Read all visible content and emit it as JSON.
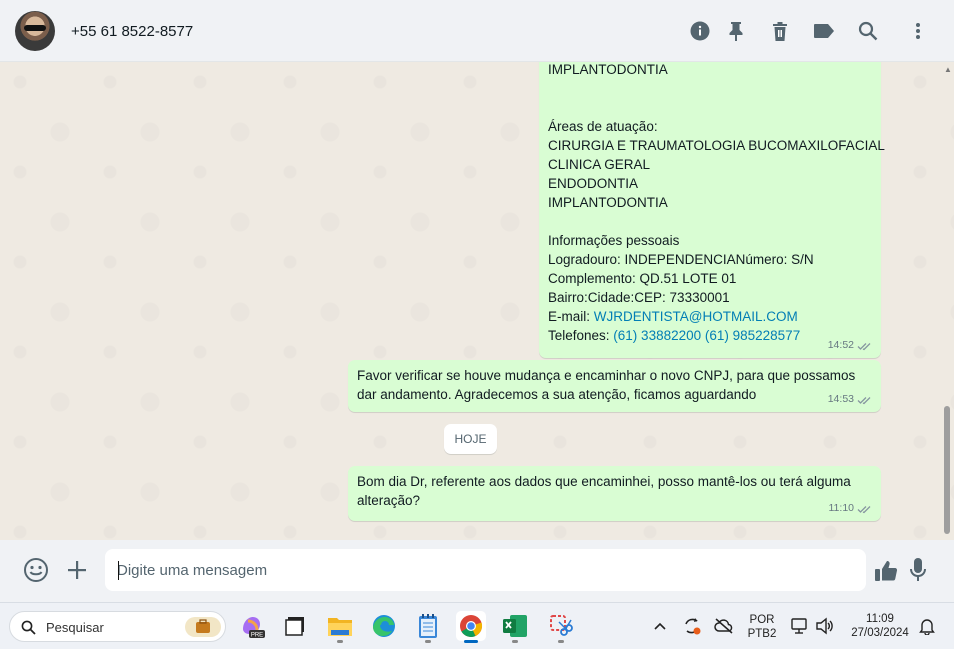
{
  "header": {
    "contact_name": "+55 61 8522-8577",
    "icons": [
      "info-icon",
      "pin-icon",
      "trash-icon",
      "label-icon",
      "search-icon",
      "more-icon"
    ]
  },
  "messages": [
    {
      "lines": [
        "IMPLANTODONTIA",
        "",
        "",
        "Áreas de atuação:",
        "CIRURGIA E TRAUMATOLOGIA BUCOMAXILOFACIAL",
        "CLINICA GERAL",
        "ENDODONTIA",
        "IMPLANTODONTIA",
        "",
        "Informações pessoais",
        "Logradouro: INDEPENDENCIANúmero: S/N",
        "Complemento: QD.51 LOTE 01",
        "Bairro:Cidade:CEP: 73330001"
      ],
      "email_label": "E-mail: ",
      "email": "WJRDENTISTA@HOTMAIL.COM",
      "phones_label": "Telefones: ",
      "phones": "(61) 33882200 (61) 985228577",
      "time": "14:52"
    },
    {
      "lines": [
        "Favor verificar se houve mudança e encaminhar o novo CNPJ, para que possamos",
        "dar andamento. Agradecemos a sua atenção, ficamos aguardando"
      ],
      "time": "14:53"
    },
    {
      "lines": [
        "Bom dia Dr, referente aos dados que encaminhei, posso mantê-los ou terá alguma",
        "alteração?"
      ],
      "time": "11:10"
    }
  ],
  "date_divider": "HOJE",
  "composer": {
    "placeholder": "Digite uma mensagem"
  },
  "taskbar": {
    "search_label": "Pesquisar",
    "lang_line1": "POR",
    "lang_line2": "PTB2",
    "time": "11:09",
    "date": "27/03/2024"
  },
  "colors": {
    "bubble_out": "#d9fdd3",
    "chat_bg": "#efeae2",
    "header_bg": "#f0f2f5",
    "link": "#027eb5"
  }
}
